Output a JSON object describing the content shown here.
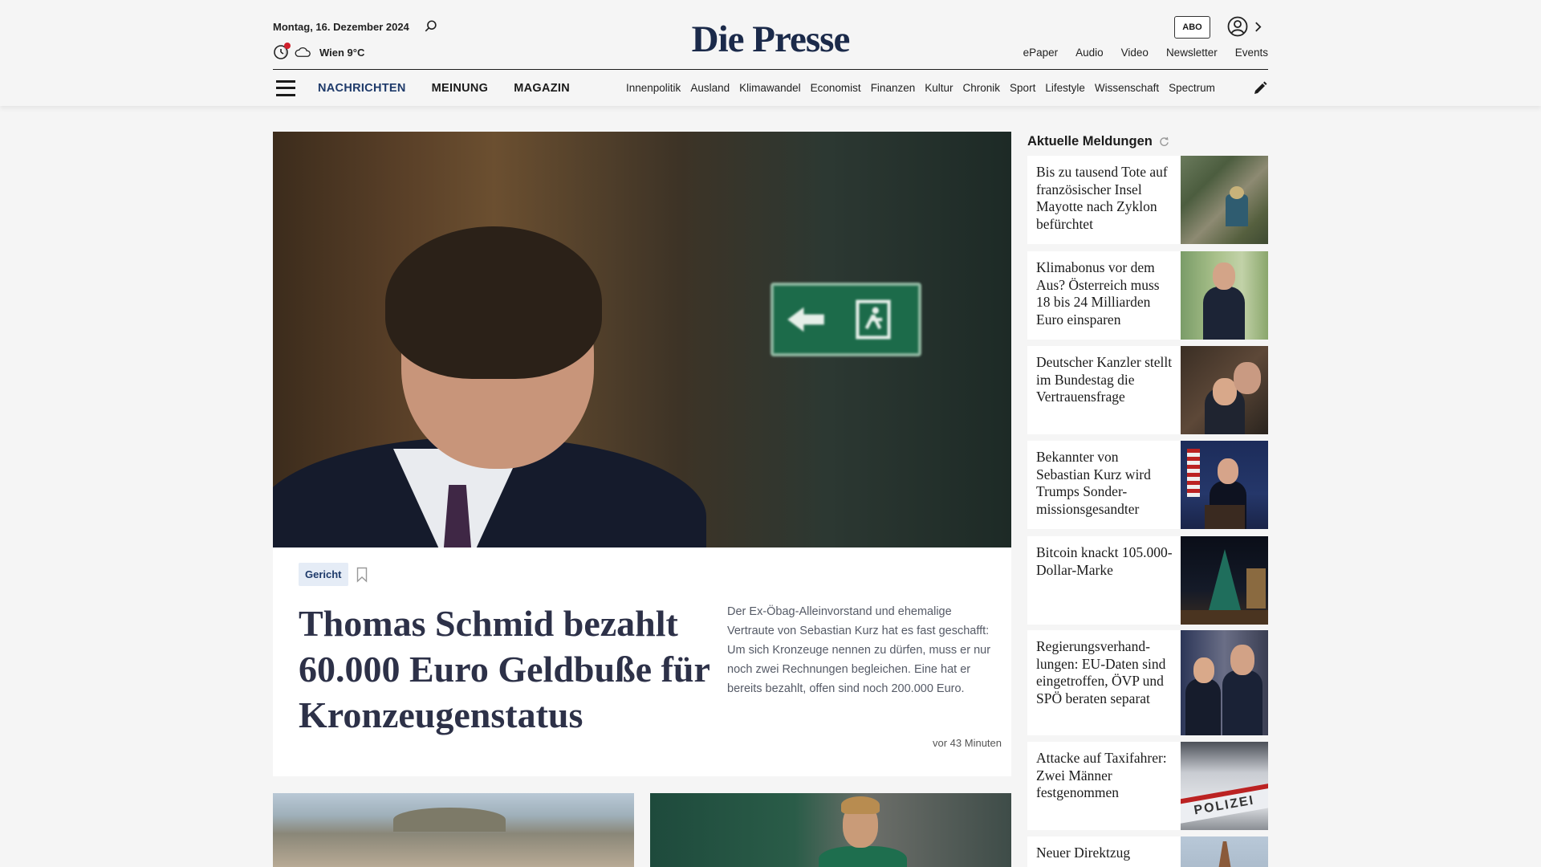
{
  "header": {
    "date": "Montag, 16. Dezember 2024",
    "weather": "Wien 9°C",
    "logo": "Die Presse",
    "abo": "ABO",
    "top_links": [
      "ePaper",
      "Audio",
      "Video",
      "Newsletter",
      "Events"
    ],
    "main_nav": [
      "NACHRICHTEN",
      "MEINUNG",
      "MAGAZIN"
    ],
    "sub_nav": [
      "Innenpolitik",
      "Ausland",
      "Klimawandel",
      "Economist",
      "Finanzen",
      "Kultur",
      "Chronik",
      "Sport",
      "Lifestyle",
      "Wissenschaft",
      "Spectrum"
    ]
  },
  "hero": {
    "tag": "Gericht",
    "title": "Thomas Schmid bezahlt 60.000 Euro Geldbuße für Kronzeugenstatus",
    "teaser": "Der Ex-Öbag-Alleinvorstand und ehemalige Vertraute von Sebastian Kurz hat es fast geschafft: Um sich Kronzeuge nennen zu dürfen, muss er nur noch zwei Rechnungen begleichen. Eine hat er bereits bezahlt, offen sind noch 200.000 Euro.",
    "time": "vor 43 Minuten"
  },
  "sidebar": {
    "title": "Aktuelle Meldungen",
    "items": [
      {
        "text": "Bis zu tausend Tote auf französischer Insel Mayotte nach Zyklon befürchtet"
      },
      {
        "text": "Klimabonus vor dem Aus? Österreich muss 18 bis 24 Milliarden Euro einsparen"
      },
      {
        "text": "Deutscher Kanzler stellt im Bundestag die Vertrauensfrage"
      },
      {
        "text": "Bekannter von Sebastian Kurz wird Trumps Sonder-missionsgesandter"
      },
      {
        "text": "Bitcoin knackt 105.000-Dollar-Marke"
      },
      {
        "text": "Regierungsverhand-lungen: EU-Daten sind eingetroffen, ÖVP und SPÖ beraten separat"
      },
      {
        "text": "Attacke auf Taxifahrer: Zwei Männer festgenommen"
      },
      {
        "text": "Neuer Direktzug"
      }
    ]
  },
  "colors": {
    "brand": "#1b2a4a",
    "nav_active": "#1e3a6a",
    "tag_bg": "#e5ecf6",
    "notification": "#d0202c"
  },
  "icons": [
    "search-icon",
    "moon-icon",
    "cloud-icon",
    "user-icon",
    "chevron-right-icon",
    "menu-icon",
    "pencil-icon",
    "bookmark-icon",
    "refresh-icon"
  ]
}
